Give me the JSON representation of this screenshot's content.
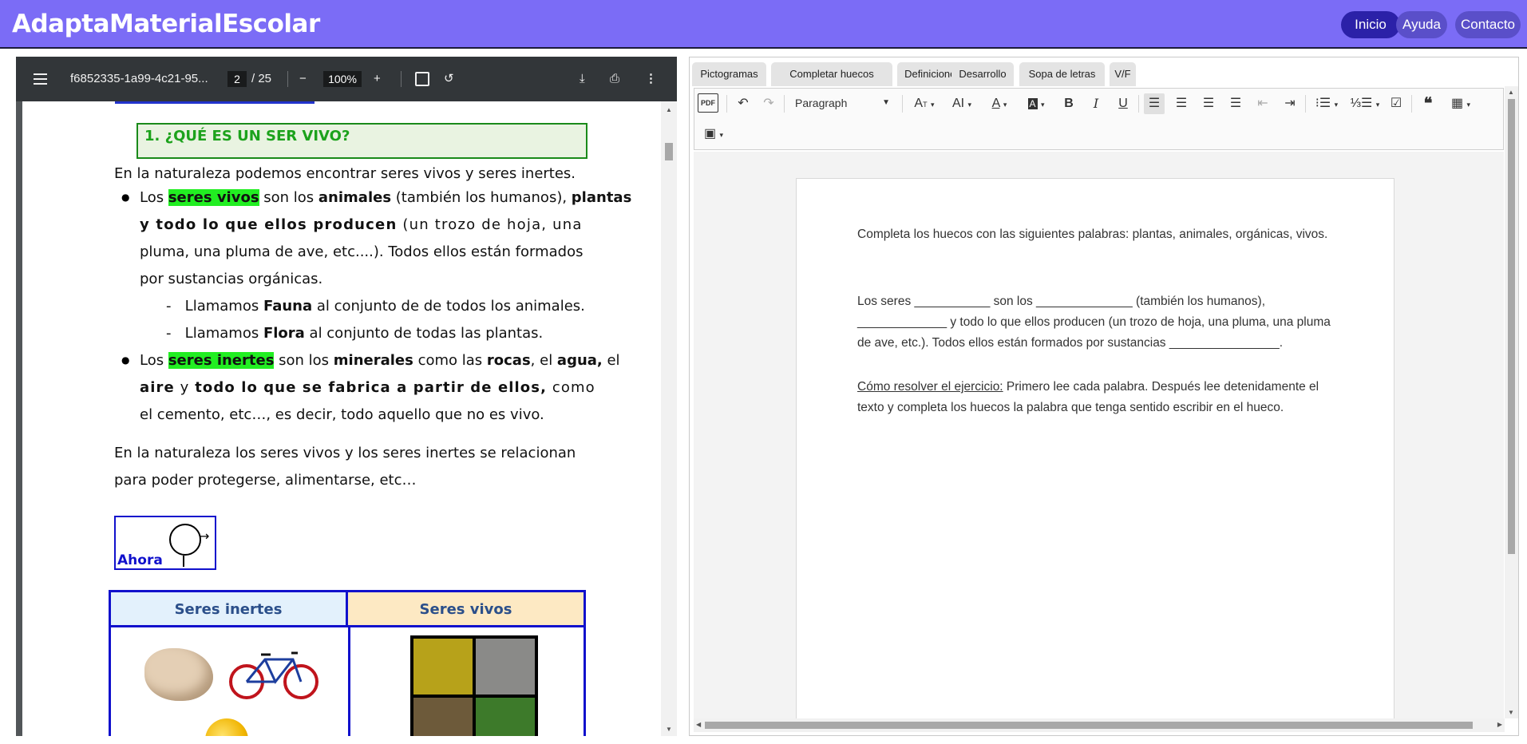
{
  "app": {
    "brand": "AdaptaMaterialEscolar",
    "nav": {
      "inicio": "Inicio",
      "ayuda": "Ayuda",
      "contacto": "Contacto"
    }
  },
  "pdf_viewer": {
    "filename": "f6852335-1a99-4c21-95...",
    "current_page": "2",
    "page_total": "/ 25",
    "zoom": "100%",
    "icons": [
      "menu-icon",
      "zoom-out-icon",
      "zoom-in-icon",
      "fit-page-icon",
      "rotate-icon",
      "download-icon",
      "print-icon",
      "more-icon"
    ],
    "page": {
      "heading": "1. ¿QUÉ ES UN SER VIVO?",
      "intro": "En la naturaleza podemos encontrar seres vivos y seres inertes.",
      "bullet1": {
        "pre": "Los ",
        "hl": "seres vivos",
        "mid1": " son los ",
        "bold1": "animales",
        "mid2": " (también los humanos), ",
        "bold2": "plantas",
        "line2_bold": "y todo lo que ellos producen",
        "line2_rest": " (un trozo de hoja, una",
        "line3": "pluma, una pluma de ave, etc....). Todos ellos están formados",
        "line4": "por sustancias orgánicas."
      },
      "sub1": {
        "dash": "-",
        "pre": "Llamamos ",
        "bold": "Fauna",
        "post": " al conjunto de de todos los animales."
      },
      "sub2": {
        "dash": "-",
        "pre": "Llamamos ",
        "bold": "Flora",
        "post": " al conjunto de todas las plantas."
      },
      "bullet2": {
        "pre": "Los ",
        "hl": "seres inertes",
        "mid1": " son los ",
        "bold1": "minerales",
        "mid2": " como las ",
        "bold2": "rocas",
        "mid3": ", el ",
        "bold3": "agua,",
        "post": " el",
        "line2_bold1": "aire",
        "line2_mid": " y ",
        "line2_bold2": "todo lo que se fabrica a partir de ellos,",
        "line2_rest": " como",
        "line3": "el cemento, etc…, es decir, todo aquello que no es vivo."
      },
      "para2_line1": "En la naturaleza los seres vivos y los seres inertes se relacionan",
      "para2_line2": "para poder protegerse, alimentarse, etc…",
      "ahora_label": "Ahora",
      "table_headers": [
        "Seres inertes",
        "Seres vivos"
      ]
    }
  },
  "editor": {
    "tabs": [
      "Pictogramas",
      "Completar huecos",
      "Definiciones",
      "Desarrollo",
      "Sopa de letras",
      "V/F"
    ],
    "paragraph_style": "Paragraph",
    "document": {
      "instruction": "Completa los huecos con las siguientes palabras: plantas, animales, orgánicas, vivos.",
      "exercise": "Los seres ___________ son los ______________ (también los humanos), _____________ y todo lo que ellos producen (un trozo de hoja, una pluma, una pluma de ave, etc.). Todos ellos están formados por sustancias ________________.",
      "howto_label": "Cómo resolver el ejercicio:",
      "howto_text": " Primero lee cada palabra. Después lee detenidamente el texto y completa los huecos la palabra que tenga sentido escribir en el hueco."
    }
  },
  "colors": {
    "topbar": "#7b6cf6",
    "nav_active": "#2b21a8",
    "highlight": "#22ee22",
    "heading_green": "#1ca21c",
    "table_blue": "#1111cc"
  }
}
